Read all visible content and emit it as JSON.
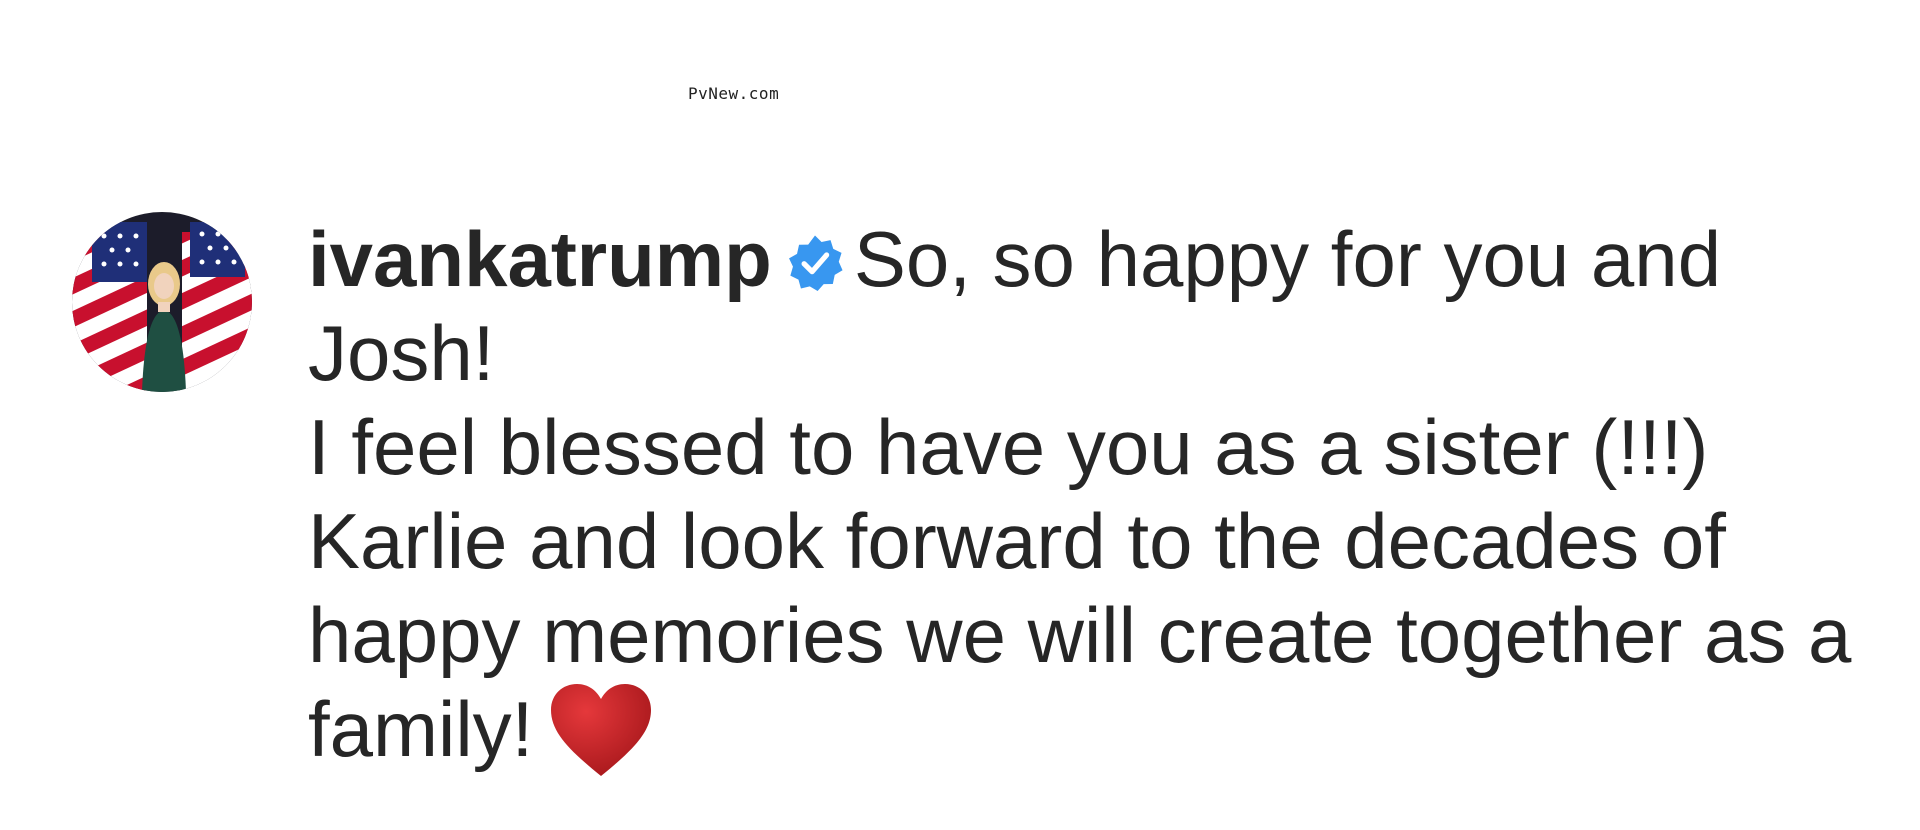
{
  "watermark": "PvNew.com",
  "comment": {
    "username": "ivankatrump",
    "verified": true,
    "text_line1": "So, so happy for you and Josh!",
    "text_line2": "I feel blessed to have you as a sister (!!!) Karlie and look forward to the decades of happy memories we will create together as a family!",
    "emoji": "heart-icon"
  },
  "colors": {
    "text": "#262626",
    "verified_badge": "#3897f0",
    "heart": "#c1121f"
  }
}
